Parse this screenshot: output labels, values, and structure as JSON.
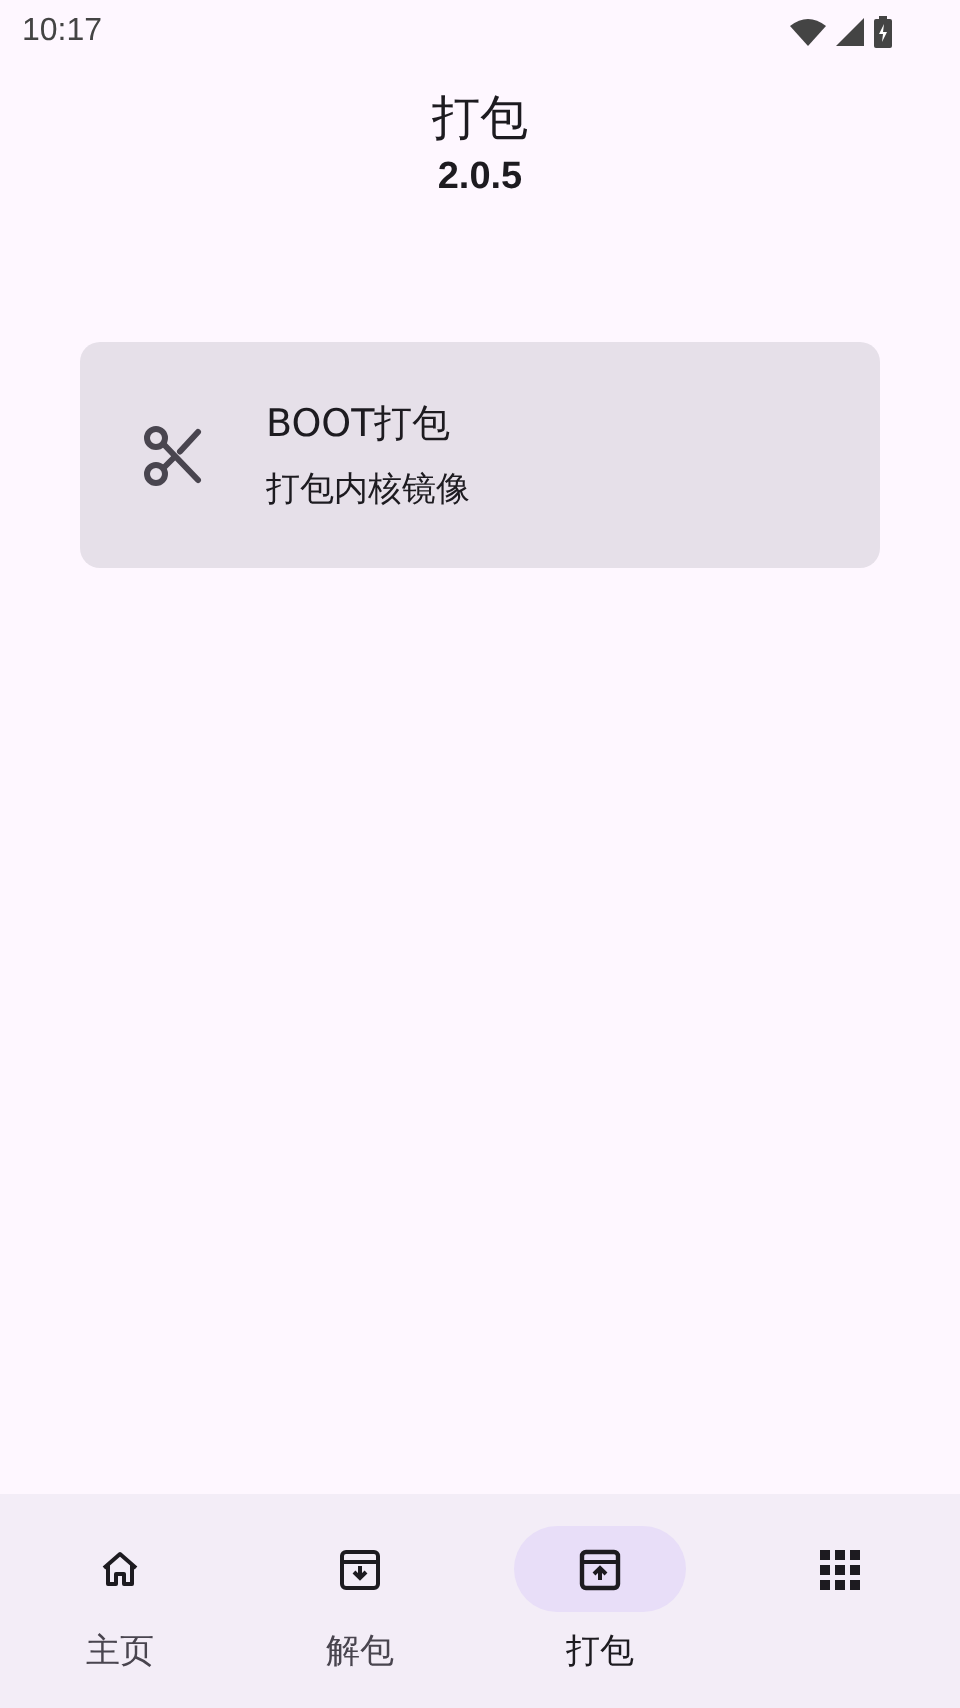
{
  "status_bar": {
    "time": "10:17"
  },
  "header": {
    "title": "打包",
    "version": "2.0.5"
  },
  "cards": [
    {
      "kind": "scissors",
      "title": "BOOT打包",
      "subtitle": "打包内核镜像"
    }
  ],
  "nav": [
    {
      "kind": "home",
      "label": "主页",
      "selected": false
    },
    {
      "kind": "download",
      "label": "解包",
      "selected": false
    },
    {
      "kind": "upload",
      "label": "打包",
      "selected": true
    },
    {
      "kind": "apps",
      "selected": false
    }
  ]
}
